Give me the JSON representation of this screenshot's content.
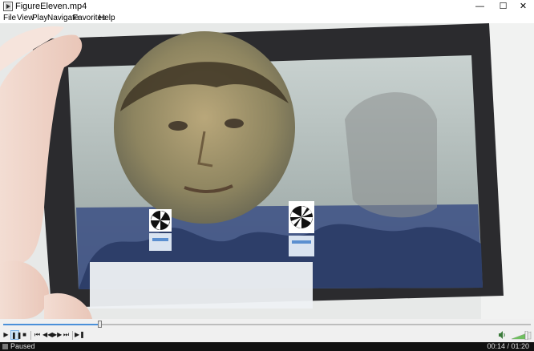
{
  "window": {
    "title": "FigureEleven.mp4",
    "minimize": "—",
    "maximize": "☐",
    "close": "✕"
  },
  "menu": [
    "File",
    "View",
    "Play",
    "Navigate",
    "Favorites",
    "Help"
  ],
  "video": {
    "description_icon": "video-frame"
  },
  "seek": {
    "position_fraction": 0.183
  },
  "controls": {
    "play": "▶",
    "pause": "❚❚",
    "stop": "■",
    "prev": "⏮",
    "rewind": "◀◀",
    "forward": "▶▶",
    "next": "⏭",
    "frame_step": "▶❚"
  },
  "status": {
    "state": "Paused",
    "time": "00:14 / 01:20"
  },
  "colors": {
    "status_bg": "#111111",
    "accent": "#4a90d9"
  }
}
